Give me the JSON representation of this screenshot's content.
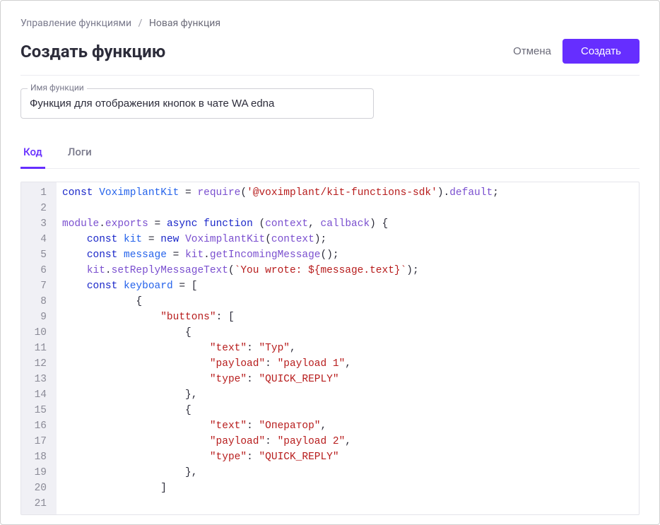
{
  "breadcrumb": {
    "link": "Управление функциями",
    "sep": "/",
    "current": "Новая функция"
  },
  "page": {
    "title": "Создать функцию",
    "cancel": "Отмена",
    "create": "Создать"
  },
  "field": {
    "label": "Имя функции",
    "value": "Функция для отображения кнопок в чате WA edna"
  },
  "tabs": {
    "code": "Код",
    "logs": "Логи"
  },
  "code": {
    "lines": [
      [
        {
          "c": "tok-kw",
          "t": "const"
        },
        {
          "c": "",
          "t": " "
        },
        {
          "c": "tok-def",
          "t": "VoximplantKit"
        },
        {
          "c": "",
          "t": " = "
        },
        {
          "c": "tok-id",
          "t": "require"
        },
        {
          "c": "",
          "t": "("
        },
        {
          "c": "tok-str",
          "t": "'@voximplant/kit-functions-sdk'"
        },
        {
          "c": "",
          "t": ")."
        },
        {
          "c": "tok-id",
          "t": "default"
        },
        {
          "c": "",
          "t": ";"
        }
      ],
      [],
      [
        {
          "c": "tok-id",
          "t": "module"
        },
        {
          "c": "",
          "t": "."
        },
        {
          "c": "tok-id",
          "t": "exports"
        },
        {
          "c": "",
          "t": " = "
        },
        {
          "c": "tok-kw",
          "t": "async"
        },
        {
          "c": "",
          "t": " "
        },
        {
          "c": "tok-kw",
          "t": "function"
        },
        {
          "c": "",
          "t": " ("
        },
        {
          "c": "tok-id",
          "t": "context"
        },
        {
          "c": "",
          "t": ", "
        },
        {
          "c": "tok-id",
          "t": "callback"
        },
        {
          "c": "",
          "t": ") {"
        }
      ],
      [
        {
          "c": "",
          "t": "    "
        },
        {
          "c": "tok-kw",
          "t": "const"
        },
        {
          "c": "",
          "t": " "
        },
        {
          "c": "tok-def",
          "t": "kit"
        },
        {
          "c": "",
          "t": " = "
        },
        {
          "c": "tok-kw",
          "t": "new"
        },
        {
          "c": "",
          "t": " "
        },
        {
          "c": "tok-id",
          "t": "VoximplantKit"
        },
        {
          "c": "",
          "t": "("
        },
        {
          "c": "tok-id",
          "t": "context"
        },
        {
          "c": "",
          "t": ");"
        }
      ],
      [
        {
          "c": "",
          "t": "    "
        },
        {
          "c": "tok-kw",
          "t": "const"
        },
        {
          "c": "",
          "t": " "
        },
        {
          "c": "tok-def",
          "t": "message"
        },
        {
          "c": "",
          "t": " = "
        },
        {
          "c": "tok-id",
          "t": "kit"
        },
        {
          "c": "",
          "t": "."
        },
        {
          "c": "tok-id",
          "t": "getIncomingMessage"
        },
        {
          "c": "",
          "t": "();"
        }
      ],
      [
        {
          "c": "",
          "t": "    "
        },
        {
          "c": "tok-id",
          "t": "kit"
        },
        {
          "c": "",
          "t": "."
        },
        {
          "c": "tok-id",
          "t": "setReplyMessageText"
        },
        {
          "c": "",
          "t": "("
        },
        {
          "c": "tok-str",
          "t": "`You wrote: ${message.text}`"
        },
        {
          "c": "",
          "t": ");"
        }
      ],
      [
        {
          "c": "",
          "t": "    "
        },
        {
          "c": "tok-kw",
          "t": "const"
        },
        {
          "c": "",
          "t": " "
        },
        {
          "c": "tok-def",
          "t": "keyboard"
        },
        {
          "c": "",
          "t": " = ["
        }
      ],
      [
        {
          "c": "",
          "t": "            {"
        }
      ],
      [
        {
          "c": "",
          "t": "                "
        },
        {
          "c": "tok-str",
          "t": "\"buttons\""
        },
        {
          "c": "",
          "t": ": ["
        }
      ],
      [
        {
          "c": "",
          "t": "                    {"
        }
      ],
      [
        {
          "c": "",
          "t": "                        "
        },
        {
          "c": "tok-str",
          "t": "\"text\""
        },
        {
          "c": "",
          "t": ": "
        },
        {
          "c": "tok-str",
          "t": "\"Тур\""
        },
        {
          "c": "",
          "t": ","
        }
      ],
      [
        {
          "c": "",
          "t": "                        "
        },
        {
          "c": "tok-str",
          "t": "\"payload\""
        },
        {
          "c": "",
          "t": ": "
        },
        {
          "c": "tok-str",
          "t": "\"payload 1\""
        },
        {
          "c": "",
          "t": ","
        }
      ],
      [
        {
          "c": "",
          "t": "                        "
        },
        {
          "c": "tok-str",
          "t": "\"type\""
        },
        {
          "c": "",
          "t": ": "
        },
        {
          "c": "tok-str",
          "t": "\"QUICK_REPLY\""
        }
      ],
      [
        {
          "c": "",
          "t": "                    },"
        }
      ],
      [
        {
          "c": "",
          "t": "                    {"
        }
      ],
      [
        {
          "c": "",
          "t": "                        "
        },
        {
          "c": "tok-str",
          "t": "\"text\""
        },
        {
          "c": "",
          "t": ": "
        },
        {
          "c": "tok-str",
          "t": "\"Оператор\""
        },
        {
          "c": "",
          "t": ","
        }
      ],
      [
        {
          "c": "",
          "t": "                        "
        },
        {
          "c": "tok-str",
          "t": "\"payload\""
        },
        {
          "c": "",
          "t": ": "
        },
        {
          "c": "tok-str",
          "t": "\"payload 2\""
        },
        {
          "c": "",
          "t": ","
        }
      ],
      [
        {
          "c": "",
          "t": "                        "
        },
        {
          "c": "tok-str",
          "t": "\"type\""
        },
        {
          "c": "",
          "t": ": "
        },
        {
          "c": "tok-str",
          "t": "\"QUICK_REPLY\""
        }
      ],
      [
        {
          "c": "",
          "t": "                    },"
        }
      ],
      [
        {
          "c": "",
          "t": "                ]"
        }
      ],
      []
    ]
  }
}
